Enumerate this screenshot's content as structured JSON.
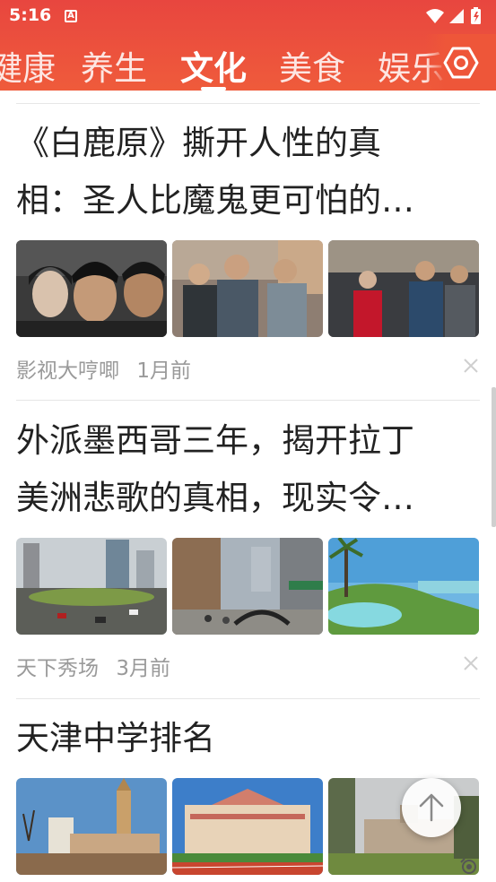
{
  "status_bar": {
    "time": "5:16",
    "notification_icon": "A"
  },
  "tabs": [
    {
      "label": "健康",
      "active": false
    },
    {
      "label": "养生",
      "active": false
    },
    {
      "label": "文化",
      "active": true
    },
    {
      "label": "美食",
      "active": false
    },
    {
      "label": "娱乐",
      "active": false
    }
  ],
  "icons": {
    "settings": "gear-icon",
    "close": "close-icon",
    "back_to_top": "arrow-up-icon",
    "accessibility": "accessibility-icon"
  },
  "colors": {
    "header": "#e8463f",
    "accent": "#ffffff",
    "title_text": "#222222",
    "meta_text": "#9a9a9a"
  },
  "articles": [
    {
      "title_lines": [
        "《白鹿原》撕开人性的真",
        "相：圣人比魔鬼更可怕的…"
      ],
      "source": "影视大哼唧",
      "time": "1月前"
    },
    {
      "title_lines": [
        "外派墨西哥三年，揭开拉丁",
        "美洲悲歌的真相，现实令…"
      ],
      "source": "天下秀场",
      "time": "3月前"
    },
    {
      "title_lines": [
        "天津中学排名"
      ]
    }
  ]
}
